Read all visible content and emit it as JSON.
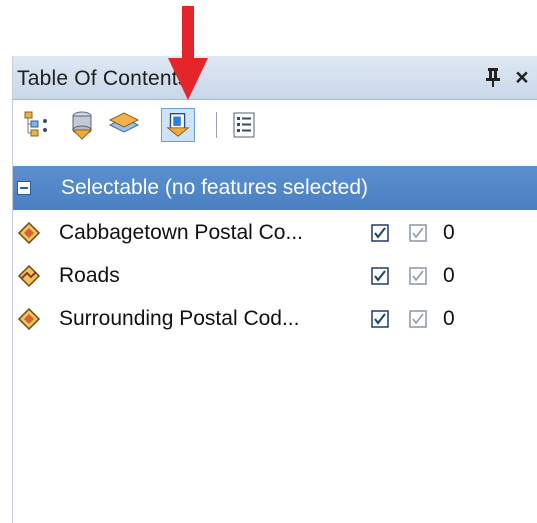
{
  "window": {
    "title": "Table Of Contents",
    "close_glyph": "×"
  },
  "toolbar": {
    "buttons": [
      {
        "name": "list-by-drawing-order",
        "icon": "layers-tree-icon"
      },
      {
        "name": "list-by-source",
        "icon": "database-icon"
      },
      {
        "name": "list-by-visibility",
        "icon": "layer-stack-icon"
      },
      {
        "name": "list-by-selection",
        "icon": "selection-layer-icon",
        "active": true
      },
      {
        "name": "options",
        "icon": "options-list-icon"
      }
    ]
  },
  "group": {
    "label": "Selectable (no features selected)"
  },
  "layers": [
    {
      "name": "Cabbagetown Postal Co...",
      "count": "0",
      "icon": "polygon-layer-icon"
    },
    {
      "name": "Roads",
      "count": "0",
      "icon": "line-layer-icon"
    },
    {
      "name": "Surrounding Postal Cod...",
      "count": "0",
      "icon": "polygon-layer-icon"
    }
  ],
  "colors": {
    "accent_arrow": "#e4262b",
    "group_header": "#5089c9",
    "titlebar": "#d4e0ef"
  }
}
